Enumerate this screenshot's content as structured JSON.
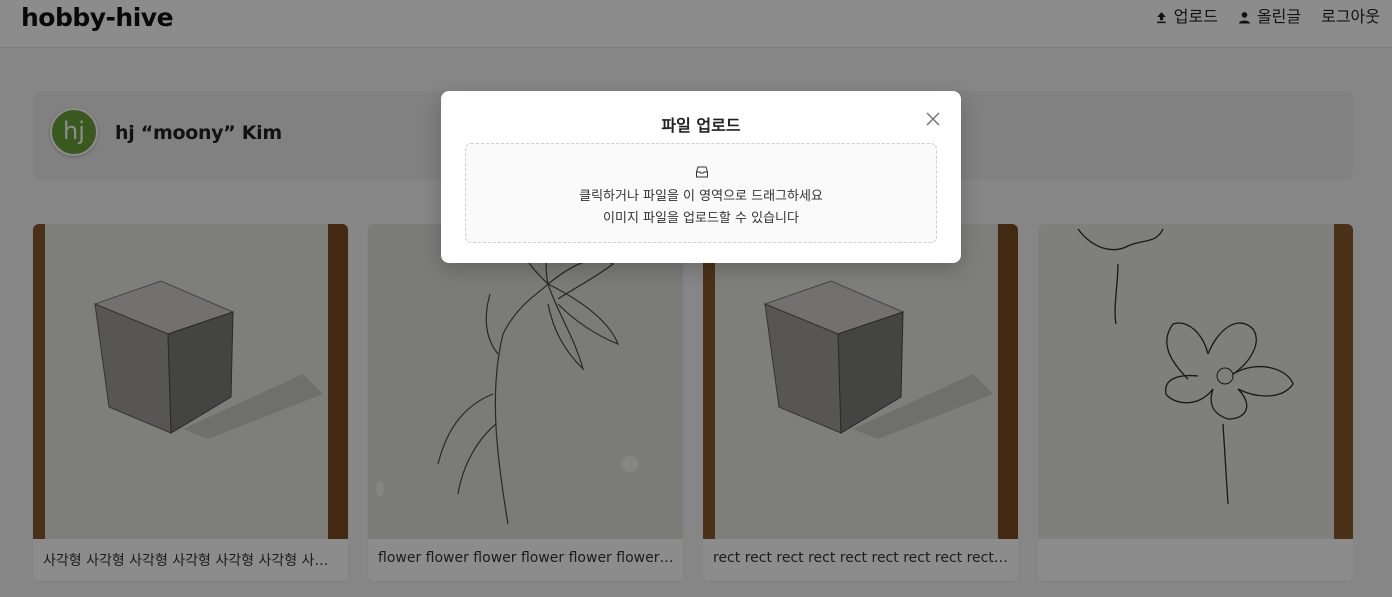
{
  "app": {
    "logo": "hobby-hive"
  },
  "nav": [
    {
      "label": "업로드",
      "icon": "upload-icon"
    },
    {
      "label": "올린글",
      "icon": "user-icon"
    },
    {
      "label": "로그아웃"
    }
  ],
  "profile": {
    "initials": "hj",
    "name": "hj “moony” Kim",
    "avatar_color": "#6aa337"
  },
  "posts": [
    {
      "caption": "사각형 사각형 사각형 사각형 사각형 사각형 사각형",
      "image": "pencil cube drawing"
    },
    {
      "caption": "flower flower flower flower flower flower flower",
      "image": "pencil lily drawing"
    },
    {
      "caption": "rect rect rect rect rect rect rect rect rect rect rect",
      "image": "pencil cube drawing"
    },
    {
      "caption": "",
      "image": "ink poppy drawing"
    }
  ],
  "modal": {
    "title": "파일 업로드",
    "close_icon": "close-icon",
    "dropzone_icon": "inbox-icon",
    "dropzone_text": "클릭하거나 파일을 이 영역으로 드래그하세요",
    "dropzone_hint": "이미지 파일을 업로드할 수 있습니다"
  }
}
